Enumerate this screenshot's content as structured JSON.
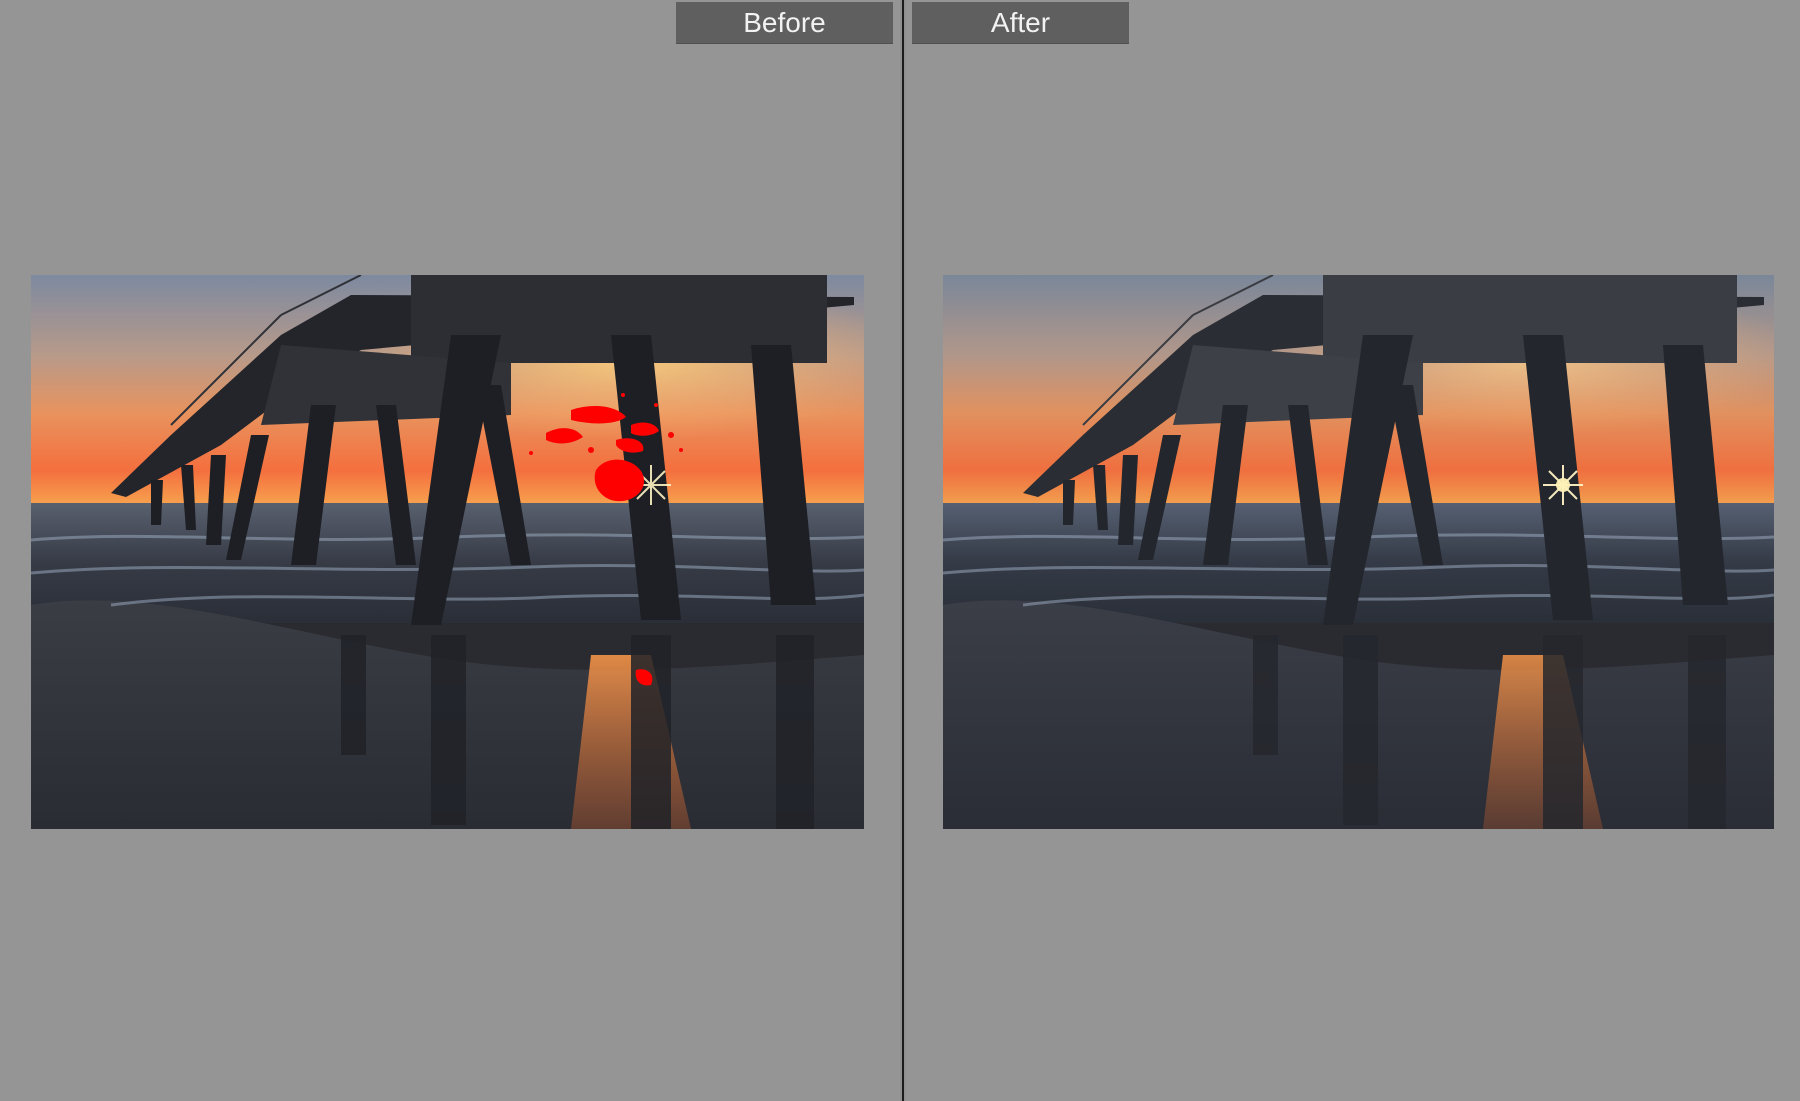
{
  "compare": {
    "before_label": "Before",
    "after_label": "After"
  },
  "colors": {
    "background": "#959595",
    "tab": "#5f5f5f",
    "tab_text": "#f2f2f2",
    "divider": "#1c1c1c",
    "clipping_warning": "#ff0000"
  },
  "images": {
    "before": {
      "clipping_highlights": true
    },
    "after": {
      "clipping_highlights": false
    }
  }
}
